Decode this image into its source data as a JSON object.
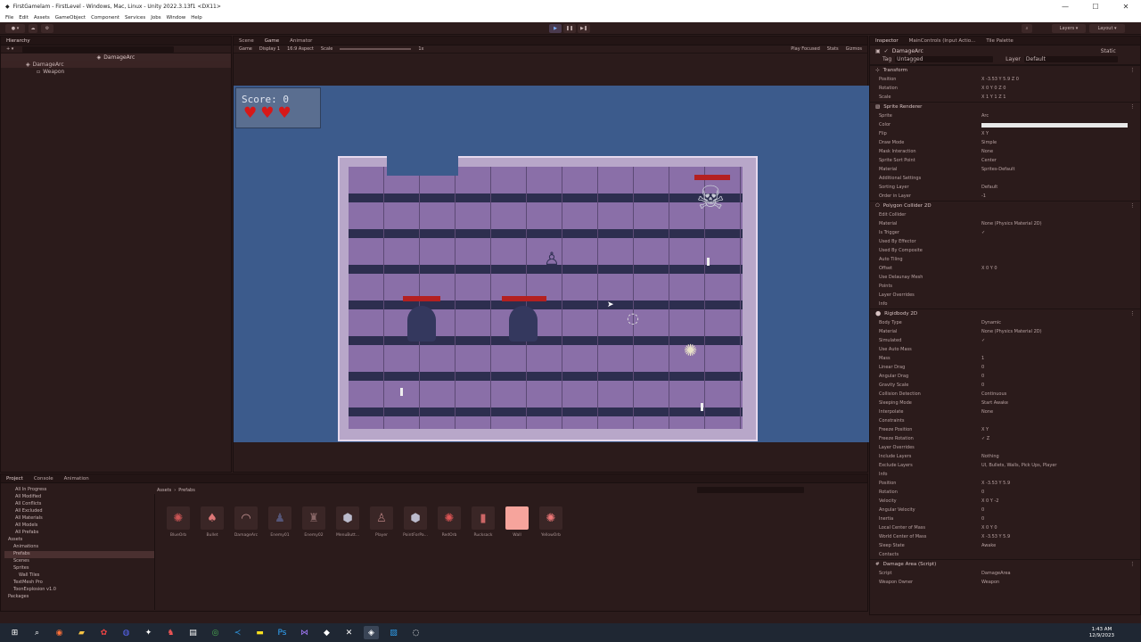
{
  "window": {
    "title": "FirstGamelam - FirstLevel - Windows, Mac, Linux - Unity 2022.3.13f1 <DX11>",
    "controls": [
      "—",
      "☐",
      "✕"
    ]
  },
  "menu": [
    "File",
    "Edit",
    "Assets",
    "GameObject",
    "Component",
    "Services",
    "Jobs",
    "Window",
    "Help"
  ],
  "toolbar": {
    "layers": "Layers",
    "layout": "Layout"
  },
  "hierarchy": {
    "tab": "Hierarchy",
    "scene_root": "DamageArc",
    "items": [
      "DamageArc",
      "Weapon"
    ]
  },
  "view_tabs": {
    "scene": "Scene",
    "game": "Game",
    "animator": "Animator"
  },
  "game_toolbar": {
    "mode": "Game",
    "display": "Display 1",
    "aspect": "16:9 Aspect",
    "scale": "Scale",
    "scale_value": "1x",
    "play_focused": "Play Focused",
    "stats": "Stats",
    "gizmos": "Gizmos"
  },
  "hud": {
    "score": "Score: 0",
    "hearts": 3
  },
  "inspector": {
    "tabs": [
      "Inspector",
      "MainControls (Input Actio...",
      "Tile Palette"
    ],
    "object_name": "DamageArc",
    "static": "Static",
    "tag_label": "Tag",
    "tag": "Untagged",
    "layer_label": "Layer",
    "layer": "Default",
    "transform": {
      "title": "Transform",
      "rows": [
        {
          "k": "Position",
          "v": "X -3.53   Y 5.9   Z 0"
        },
        {
          "k": "Rotation",
          "v": "X 0   Y 0   Z 0"
        },
        {
          "k": "Scale",
          "v": "X 1   Y 1   Z 1"
        }
      ]
    },
    "sprite_renderer": {
      "title": "Sprite Renderer",
      "rows": [
        {
          "k": "Sprite",
          "v": "Arc"
        },
        {
          "k": "Color",
          "v": ""
        },
        {
          "k": "Flip",
          "v": "X   Y"
        },
        {
          "k": "Draw Mode",
          "v": "Simple"
        },
        {
          "k": "Mask Interaction",
          "v": "None"
        },
        {
          "k": "Sprite Sort Point",
          "v": "Center"
        },
        {
          "k": "Material",
          "v": "Sprites-Default"
        },
        {
          "k": "Additional Settings",
          "v": ""
        },
        {
          "k": "Sorting Layer",
          "v": "Default"
        },
        {
          "k": "Order in Layer",
          "v": "-1"
        }
      ]
    },
    "polygon": {
      "title": "Polygon Collider 2D",
      "rows": [
        {
          "k": "Edit Collider",
          "v": ""
        },
        {
          "k": "Material",
          "v": "None (Physics Material 2D)"
        },
        {
          "k": "Is Trigger",
          "v": "✓"
        },
        {
          "k": "Used By Effector",
          "v": ""
        },
        {
          "k": "Used By Composite",
          "v": ""
        },
        {
          "k": "Auto Tiling",
          "v": ""
        },
        {
          "k": "Offset",
          "v": "X 0   Y 0"
        },
        {
          "k": "Use Delaunay Mesh",
          "v": ""
        },
        {
          "k": "Points",
          "v": ""
        },
        {
          "k": "Layer Overrides",
          "v": ""
        },
        {
          "k": "Info",
          "v": ""
        }
      ]
    },
    "rigidbody": {
      "title": "Rigidbody 2D",
      "rows": [
        {
          "k": "Body Type",
          "v": "Dynamic"
        },
        {
          "k": "Material",
          "v": "None (Physics Material 2D)"
        },
        {
          "k": "Simulated",
          "v": "✓"
        },
        {
          "k": "Use Auto Mass",
          "v": ""
        },
        {
          "k": "Mass",
          "v": "1"
        },
        {
          "k": "Linear Drag",
          "v": "0"
        },
        {
          "k": "Angular Drag",
          "v": "0"
        },
        {
          "k": "Gravity Scale",
          "v": "0"
        },
        {
          "k": "Collision Detection",
          "v": "Continuous"
        },
        {
          "k": "Sleeping Mode",
          "v": "Start Awake"
        },
        {
          "k": "Interpolate",
          "v": "None"
        },
        {
          "k": "Constraints",
          "v": ""
        },
        {
          "k": "Freeze Position",
          "v": "X   Y"
        },
        {
          "k": "Freeze Rotation",
          "v": "✓ Z"
        },
        {
          "k": "Layer Overrides",
          "v": ""
        },
        {
          "k": "Include Layers",
          "v": "Nothing"
        },
        {
          "k": "Exclude Layers",
          "v": "UI, Bullets, Walls, Pick Ups, Player"
        },
        {
          "k": "Info",
          "v": ""
        },
        {
          "k": "Position",
          "v": "X -3.53   Y 5.9"
        },
        {
          "k": "Rotation",
          "v": "0"
        },
        {
          "k": "Velocity",
          "v": "X 0   Y -2"
        },
        {
          "k": "Angular Velocity",
          "v": "0"
        },
        {
          "k": "Inertia",
          "v": "0"
        },
        {
          "k": "Local Center of Mass",
          "v": "X 0   Y 0"
        },
        {
          "k": "World Center of Mass",
          "v": "X -3.53   Y 5.9"
        },
        {
          "k": "Sleep State",
          "v": "Awake"
        },
        {
          "k": "Contacts",
          "v": ""
        }
      ]
    },
    "script": {
      "title": "Damage Area (Script)",
      "rows": [
        {
          "k": "Script",
          "v": "DamageArea"
        },
        {
          "k": "Weapon Owner",
          "v": "Weapon"
        }
      ]
    }
  },
  "bottom": {
    "tabs": [
      "Project",
      "Console",
      "Animation"
    ],
    "path": [
      "Assets",
      "Prefabs"
    ],
    "tree": [
      "All In Progress",
      "All Modified",
      "All Conflicts",
      "All Excluded",
      "All Materials",
      "All Models",
      "All Prefabs",
      "Assets",
      "Animations",
      "Prefabs",
      "Scenes",
      "Sprites",
      "Wall Tiles",
      "TextMesh Pro",
      "ToonExplosion v1.0",
      "Packages"
    ],
    "assets": [
      {
        "name": "BlueOrb",
        "icon": "✺",
        "color": "#c55"
      },
      {
        "name": "Bullet",
        "icon": "♠",
        "color": "#d77"
      },
      {
        "name": "DamageArc",
        "icon": "◠",
        "color": "#c99"
      },
      {
        "name": "Enemy01",
        "icon": "♟",
        "color": "#557"
      },
      {
        "name": "Enemy02",
        "icon": "♜",
        "color": "#866"
      },
      {
        "name": "MenuButt...",
        "icon": "⬢",
        "color": "#bbc"
      },
      {
        "name": "Player",
        "icon": "♙",
        "color": "#a77"
      },
      {
        "name": "PointForPa...",
        "icon": "⬢",
        "color": "#bbc"
      },
      {
        "name": "RedOrb",
        "icon": "✺",
        "color": "#d55"
      },
      {
        "name": "Rucksack",
        "icon": "▮",
        "color": "#c66"
      },
      {
        "name": "Wall",
        "icon": "■",
        "color": "#f6a49c"
      },
      {
        "name": "YellowOrb",
        "icon": "✺",
        "color": "#e77"
      }
    ]
  },
  "taskbar": {
    "time": "1:43 AM",
    "date": "12/9/2023"
  }
}
